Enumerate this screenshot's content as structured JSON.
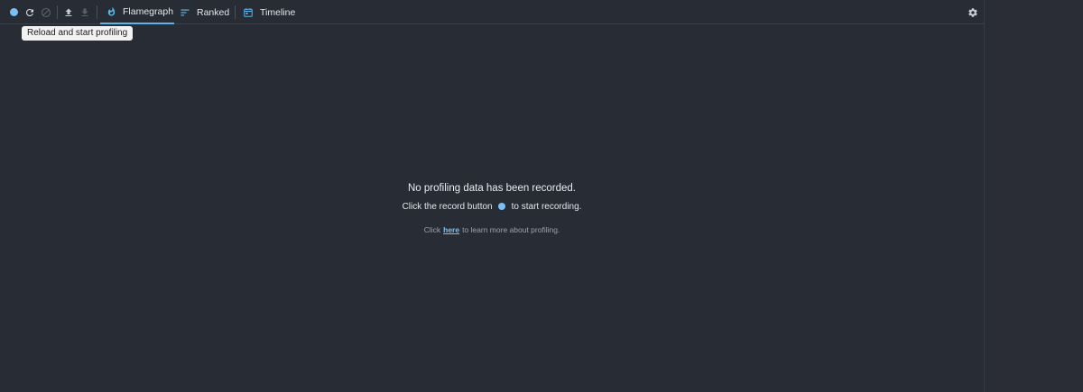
{
  "toolbar": {
    "record_button": {
      "icon": "record-dot-icon",
      "color": "#79c0f6"
    },
    "reload_button": {
      "icon": "reload-icon"
    },
    "clear_button": {
      "icon": "clear-icon",
      "disabled": true
    },
    "load_button": {
      "icon": "upload-icon"
    },
    "save_button": {
      "icon": "download-icon",
      "disabled": true
    },
    "tabs": [
      {
        "label": "Flamegraph",
        "icon": "flame-icon",
        "active": true
      },
      {
        "label": "Ranked",
        "icon": "ranked-icon",
        "active": false
      },
      {
        "label": "Timeline",
        "icon": "timeline-icon",
        "active": false
      }
    ],
    "settings_button": {
      "icon": "gear-icon"
    }
  },
  "tooltip": {
    "text": "Reload and start profiling"
  },
  "empty_state": {
    "title": "No profiling data has been recorded.",
    "instruction_before": "Click the record button",
    "instruction_after": "to start recording.",
    "learn_before": "Click",
    "learn_link": "here",
    "learn_after": "to learn more about profiling."
  },
  "colors": {
    "background": "#282c34",
    "accent": "#79c0f6",
    "text": "#e3e6eb",
    "muted_text": "#9ba3ae"
  }
}
